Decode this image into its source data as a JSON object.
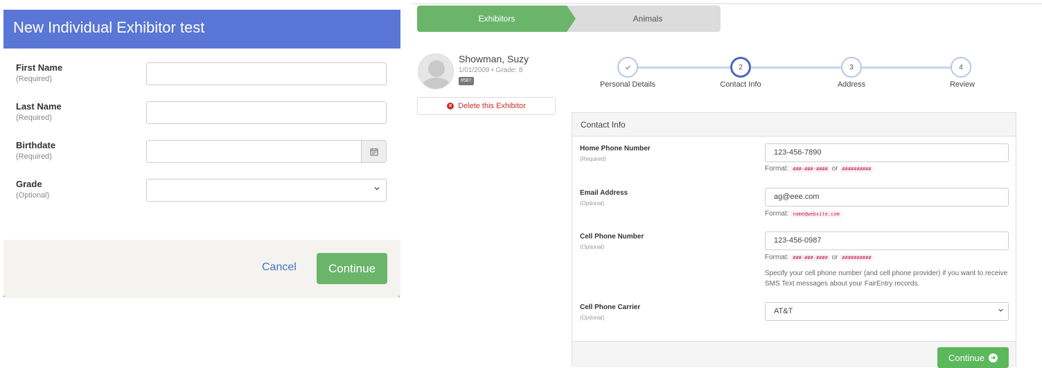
{
  "modal": {
    "title": "New Individual Exhibitor test",
    "fields": [
      {
        "label": "First Name",
        "hint": "(Required)",
        "value": ""
      },
      {
        "label": "Last Name",
        "hint": "(Required)",
        "value": ""
      },
      {
        "label": "Birthdate",
        "hint": "(Required)",
        "value": ""
      },
      {
        "label": "Grade",
        "hint": "(Optional)",
        "value": ""
      }
    ],
    "cancel_label": "Cancel",
    "continue_label": "Continue"
  },
  "wizard_tabs": [
    {
      "label": "Exhibitors",
      "active": true
    },
    {
      "label": "Animals",
      "active": false
    }
  ],
  "exhibitor": {
    "name": "Showman, Suzy",
    "meta": "1/01/2009 • Grade: 8",
    "badge": "#587",
    "delete_label": "Delete this Exhibitor"
  },
  "steps": [
    {
      "number": "",
      "label": "Personal Details",
      "state": "done"
    },
    {
      "number": "2",
      "label": "Contact Info",
      "state": "active"
    },
    {
      "number": "3",
      "label": "Address",
      "state": "pending"
    },
    {
      "number": "4",
      "label": "Review",
      "state": "pending"
    }
  ],
  "contact": {
    "heading": "Contact Info",
    "home_phone": {
      "label": "Home Phone Number",
      "hint": "(Required)",
      "value": "123-456-7890"
    },
    "email": {
      "label": "Email Address",
      "hint": "(Optional)",
      "value": "ag@eee.com"
    },
    "cell_phone": {
      "label": "Cell Phone Number",
      "hint": "(Optional)",
      "value": "123-456-0987"
    },
    "carrier": {
      "label": "Cell Phone Carrier",
      "hint": "(Optional)",
      "value": "AT&T"
    },
    "format_prefix": "Format:",
    "format_or": "or",
    "phone_format_1": "###-###-####",
    "phone_format_2": "##########",
    "email_format": "name@website.com",
    "sms_help": "Specify your cell phone number (and cell phone provider) if you want to receive SMS Text messages about your FairEntry records.",
    "continue_label": "Continue"
  },
  "colors": {
    "modal_header": "#5a76d6",
    "success": "#5cb85c",
    "danger": "#c9302c",
    "link": "#4a6fc4"
  },
  "icons": {
    "calendar": "calendar-icon",
    "chevron": "chevron-down-icon",
    "check": "check-icon",
    "delete": "times-circle-icon",
    "arrow": "arrow-circle-right-icon"
  }
}
